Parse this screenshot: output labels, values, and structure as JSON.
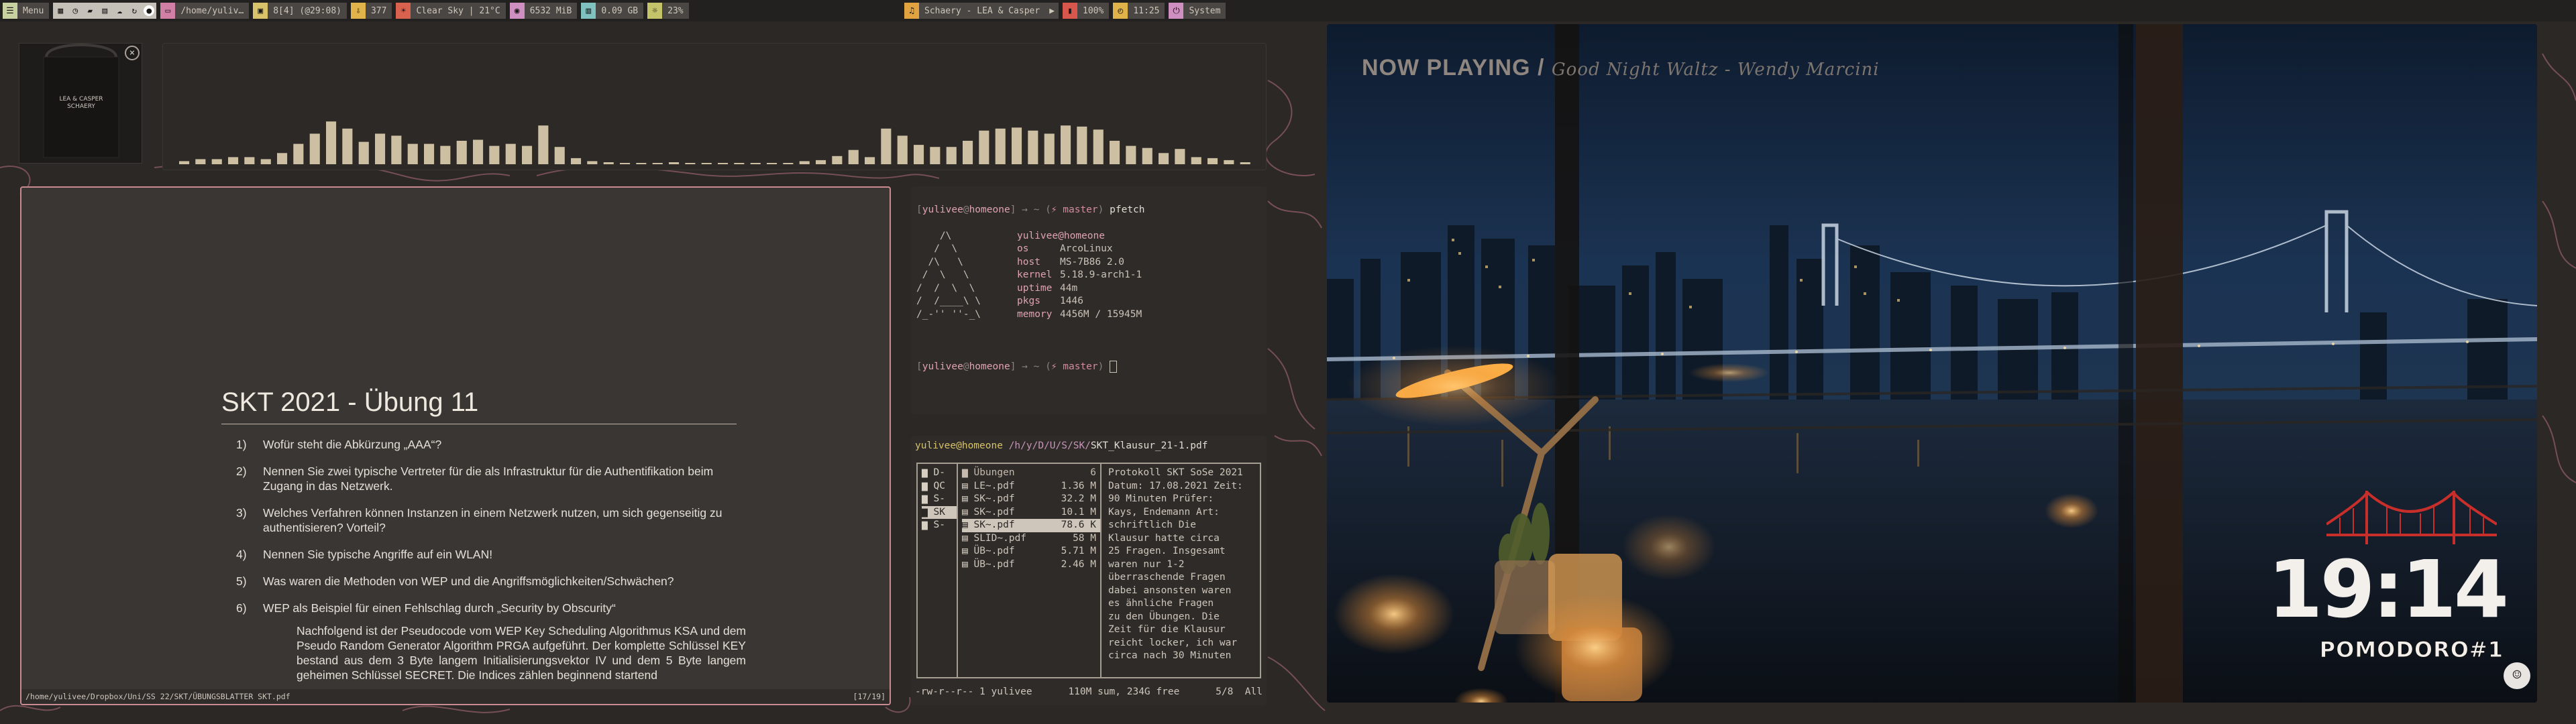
{
  "topbar": {
    "menu": "Menu",
    "workspace_path": "/home/yuliv…",
    "cpu": "8[4] (@29:08)",
    "updates": "377",
    "weather": "Clear Sky | 21°C",
    "memory": "6532 MiB",
    "disk": "0.09 GB",
    "brightness": "23%",
    "now_playing": "Schaery - LEA & Casper",
    "play_state": "▶",
    "battery": "100%",
    "time": "11:25",
    "system": "System"
  },
  "album": {
    "caption": "LEA & CASPER SCHAERY"
  },
  "visualizer": {
    "levels": [
      0.03,
      0.05,
      0.05,
      0.07,
      0.07,
      0.05,
      0.11,
      0.2,
      0.3,
      0.42,
      0.35,
      0.22,
      0.3,
      0.28,
      0.2,
      0.2,
      0.18,
      0.23,
      0.24,
      0.18,
      0.2,
      0.18,
      0.38,
      0.17,
      0.06,
      0.03,
      0.02,
      0.0,
      0.0,
      0.0,
      0.02,
      0.0,
      0.0,
      0.0,
      0.0,
      0.0,
      0.0,
      0.0,
      0.03,
      0.04,
      0.08,
      0.14,
      0.07,
      0.35,
      0.28,
      0.19,
      0.17,
      0.17,
      0.23,
      0.33,
      0.35,
      0.36,
      0.33,
      0.3,
      0.38,
      0.37,
      0.34,
      0.23,
      0.18,
      0.16,
      0.11,
      0.15,
      0.07,
      0.06,
      0.04,
      0.02
    ]
  },
  "pdf": {
    "title": "SKT 2021 - Übung 11",
    "questions": [
      {
        "num": "1)",
        "text": "Wofür steht die Abkürzung „AAA“?"
      },
      {
        "num": "2)",
        "text": "Nennen Sie zwei typische Vertreter für die als Infrastruktur für die Authentifikation beim Zugang in das Netzwerk."
      },
      {
        "num": "3)",
        "text": "Welches Verfahren können Instanzen in einem Netzwerk nutzen, um sich gegenseitig zu authentisieren? Vorteil?"
      },
      {
        "num": "4)",
        "text": "Nennen Sie typische Angriffe auf ein WLAN!"
      },
      {
        "num": "5)",
        "text": "Was waren die Methoden von WEP und die Angriffsmöglichkeiten/Schwächen?"
      },
      {
        "num": "6)",
        "text": "WEP als Beispiel für einen Fehlschlag durch „Security by Obscurity“"
      }
    ],
    "paragraph": "Nachfolgend ist der Pseudocode vom WEP Key Scheduling Algorithmus KSA und dem Pseudo Random Generator Algorithm PRGA aufgeführt. Der komplette Schlüssel KEY bestand aus dem 3 Byte langem Initialisierungsvektor IV und dem 5 Byte langem geheimen Schlüssel SECRET. Die Indices zählen beginnend startend",
    "status_path": "/home/yulivee/Dropbox/Uni/SS 22/SKT/ÜBUNGSBLATTER SKT.pdf",
    "status_page": "[17/19]"
  },
  "term1": {
    "user": "yulivee",
    "host": "homeone",
    "branch": "master",
    "command": "pfetch",
    "ascii": [
      "    /\\    ",
      "   /  \\   ",
      "  /\\   \\  ",
      " /  \\   \\ ",
      "/  /  \\  \\",
      "/  /____\\ \\",
      "/_-'' ''-_\\"
    ],
    "info": [
      {
        "key": "",
        "val": "yulivee@homeone"
      },
      {
        "key": "os",
        "val": "ArcoLinux"
      },
      {
        "key": "host",
        "val": "MS-7B86 2.0"
      },
      {
        "key": "kernel",
        "val": "5.18.9-arch1-1"
      },
      {
        "key": "uptime",
        "val": "44m"
      },
      {
        "key": "pkgs",
        "val": "1446"
      },
      {
        "key": "memory",
        "val": "4456M / 15945M"
      }
    ]
  },
  "term2": {
    "head_user": "yulivee@homeone",
    "head_path": "/h/y/D/U/S/SK/",
    "head_file": "SKT_Klausur_21-1.pdf",
    "parent_dirs": [
      "D-",
      "QC",
      "S-",
      "SK",
      "S-"
    ],
    "files": [
      {
        "name": "Übungen",
        "size": "6",
        "dir": true
      },
      {
        "name": "LE~.pdf",
        "size": "1.36 M",
        "dir": false
      },
      {
        "name": "SK~.pdf",
        "size": "32.2 M",
        "dir": false
      },
      {
        "name": "SK~.pdf",
        "size": "10.1 M",
        "dir": false
      },
      {
        "name": "SK~.pdf",
        "size": "78.6 K",
        "dir": false
      },
      {
        "name": "SLID~.pdf",
        "size": "58 M",
        "dir": false
      },
      {
        "name": "ÜB~.pdf",
        "size": "5.71 M",
        "dir": false
      },
      {
        "name": "ÜB~.pdf",
        "size": "2.46 M",
        "dir": false
      }
    ],
    "preview": [
      "Protokoll SKT SoSe 2021",
      "Datum: 17.08.2021 Zeit:",
      "90 Minuten Prüfer:",
      "Kays, Endemann Art:",
      "schriftlich Die",
      "Klausur hatte circa",
      "25 Fragen. Insgesamt",
      "waren nur 1-2",
      "überraschende Fragen",
      "dabei ansonsten waren",
      "es ähnliche Fragen",
      "zu den Übungen. Die",
      "Zeit für die Klausur",
      "reicht locker, ich war",
      "circa nach 30 Minuten"
    ],
    "status_left": "-rw-r--r-- 1 yulivee",
    "status_mid": "110M sum, 234G free",
    "status_right": "5/8  All"
  },
  "photo": {
    "np_label": "NOW PLAYING",
    "np_sep": "/",
    "np_song": "Good Night Waltz - Wendy Marcini",
    "clock": "19:14",
    "pomodoro": "POMODORO#1"
  }
}
